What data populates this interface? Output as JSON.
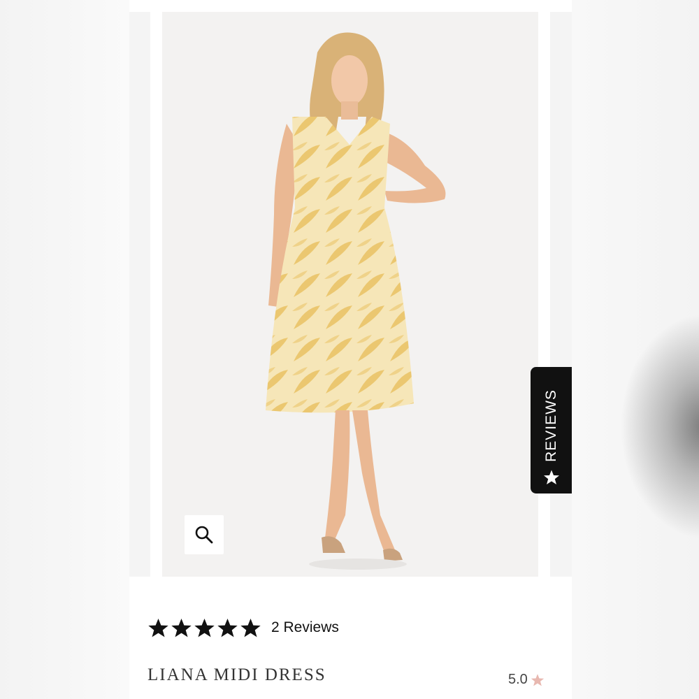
{
  "product": {
    "title": "LIANA MIDI DRESS",
    "review_count_label": "2 Reviews",
    "rating_display": "5.0",
    "stars_filled": 5,
    "stars_total": 5
  },
  "reviews_tab": {
    "label": "REVIEWS",
    "icon": "star-icon"
  },
  "zoom": {
    "icon": "magnifier-icon"
  },
  "colors": {
    "star": "#111111",
    "mini_star": "#e8b8b0",
    "tab_bg": "#111111",
    "dress": "#f1d27e"
  }
}
